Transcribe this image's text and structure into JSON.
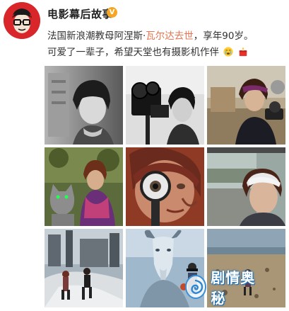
{
  "post": {
    "author": "电影幕后故事",
    "verified_badge": "V",
    "line1_prefix": "法国新浪潮教母阿涅斯·",
    "line1_mention": "瓦尔达去世",
    "line1_suffix": "，享年90岁。",
    "line2": "可爱了一辈子，希望天堂也有摄影机作伴",
    "emojis": [
      "crying-face-emoji",
      "candle-gift-emoji"
    ]
  },
  "photos": [
    {
      "name": "photo-portrait-bw",
      "tone": "bw"
    },
    {
      "name": "photo-camera-bw",
      "tone": "bw"
    },
    {
      "name": "photo-film-set",
      "tone": "color"
    },
    {
      "name": "photo-cat",
      "tone": "color"
    },
    {
      "name": "photo-magnifier",
      "tone": "color"
    },
    {
      "name": "photo-train-window",
      "tone": "color"
    },
    {
      "name": "photo-industrial",
      "tone": "color"
    },
    {
      "name": "photo-goat-mural",
      "tone": "color"
    },
    {
      "name": "photo-beach",
      "tone": "color"
    }
  ],
  "watermark": {
    "text": "剧情奥秘"
  },
  "colors": {
    "mention": "#eb7350",
    "badge": "#f5a623",
    "avatar_bg": "#d8262a"
  }
}
